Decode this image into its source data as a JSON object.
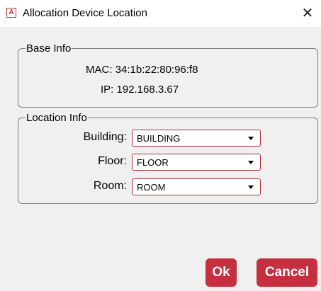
{
  "window": {
    "title": "Allocation Device Location",
    "icon": "pdf-app-icon",
    "close_glyph": "✕"
  },
  "base_info": {
    "legend": "Base Info",
    "mac_label": "MAC:",
    "mac_value": "34:1b:22:80:96:f8",
    "ip_label": "IP:",
    "ip_value": "192.168.3.67"
  },
  "location_info": {
    "legend": "Location Info",
    "building_label": "Building:",
    "building_value": "BUILDING",
    "floor_label": "Floor:",
    "floor_value": "FLOOR",
    "room_label": "Room:",
    "room_value": "ROOM"
  },
  "buttons": {
    "ok_label": "Ok",
    "cancel_label": "Cancel"
  },
  "colors": {
    "accent": "#c62f3e",
    "select_border": "#b22d3a"
  }
}
